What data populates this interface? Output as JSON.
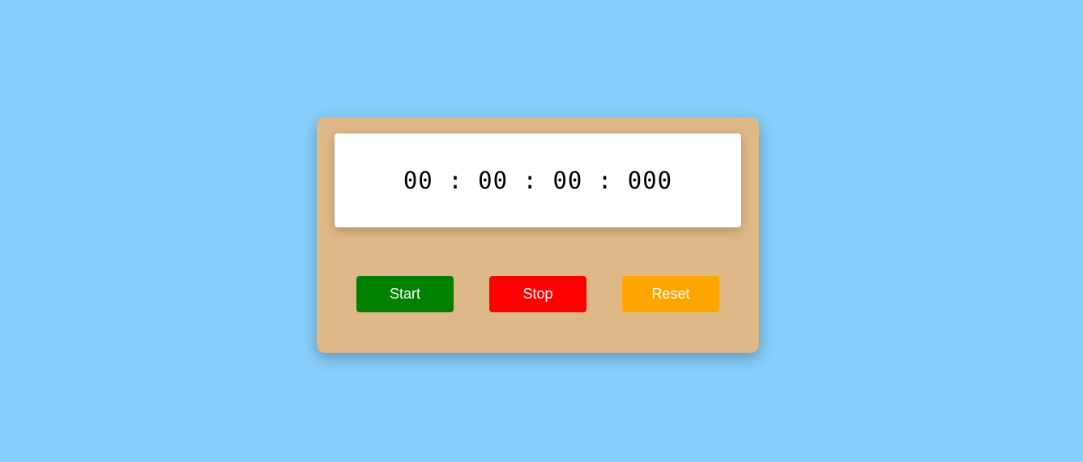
{
  "stopwatch": {
    "display": {
      "hours": "00",
      "minutes": "00",
      "seconds": "00",
      "milliseconds": "000",
      "separator": " : "
    },
    "buttons": {
      "start_label": "Start",
      "stop_label": "Stop",
      "reset_label": "Reset"
    }
  },
  "colors": {
    "page_background": "#87cefa",
    "card_background": "#deb887",
    "display_background": "#ffffff",
    "start_button": "#008000",
    "stop_button": "#ff0000",
    "reset_button": "#ffa500",
    "button_text": "#ffffff"
  }
}
